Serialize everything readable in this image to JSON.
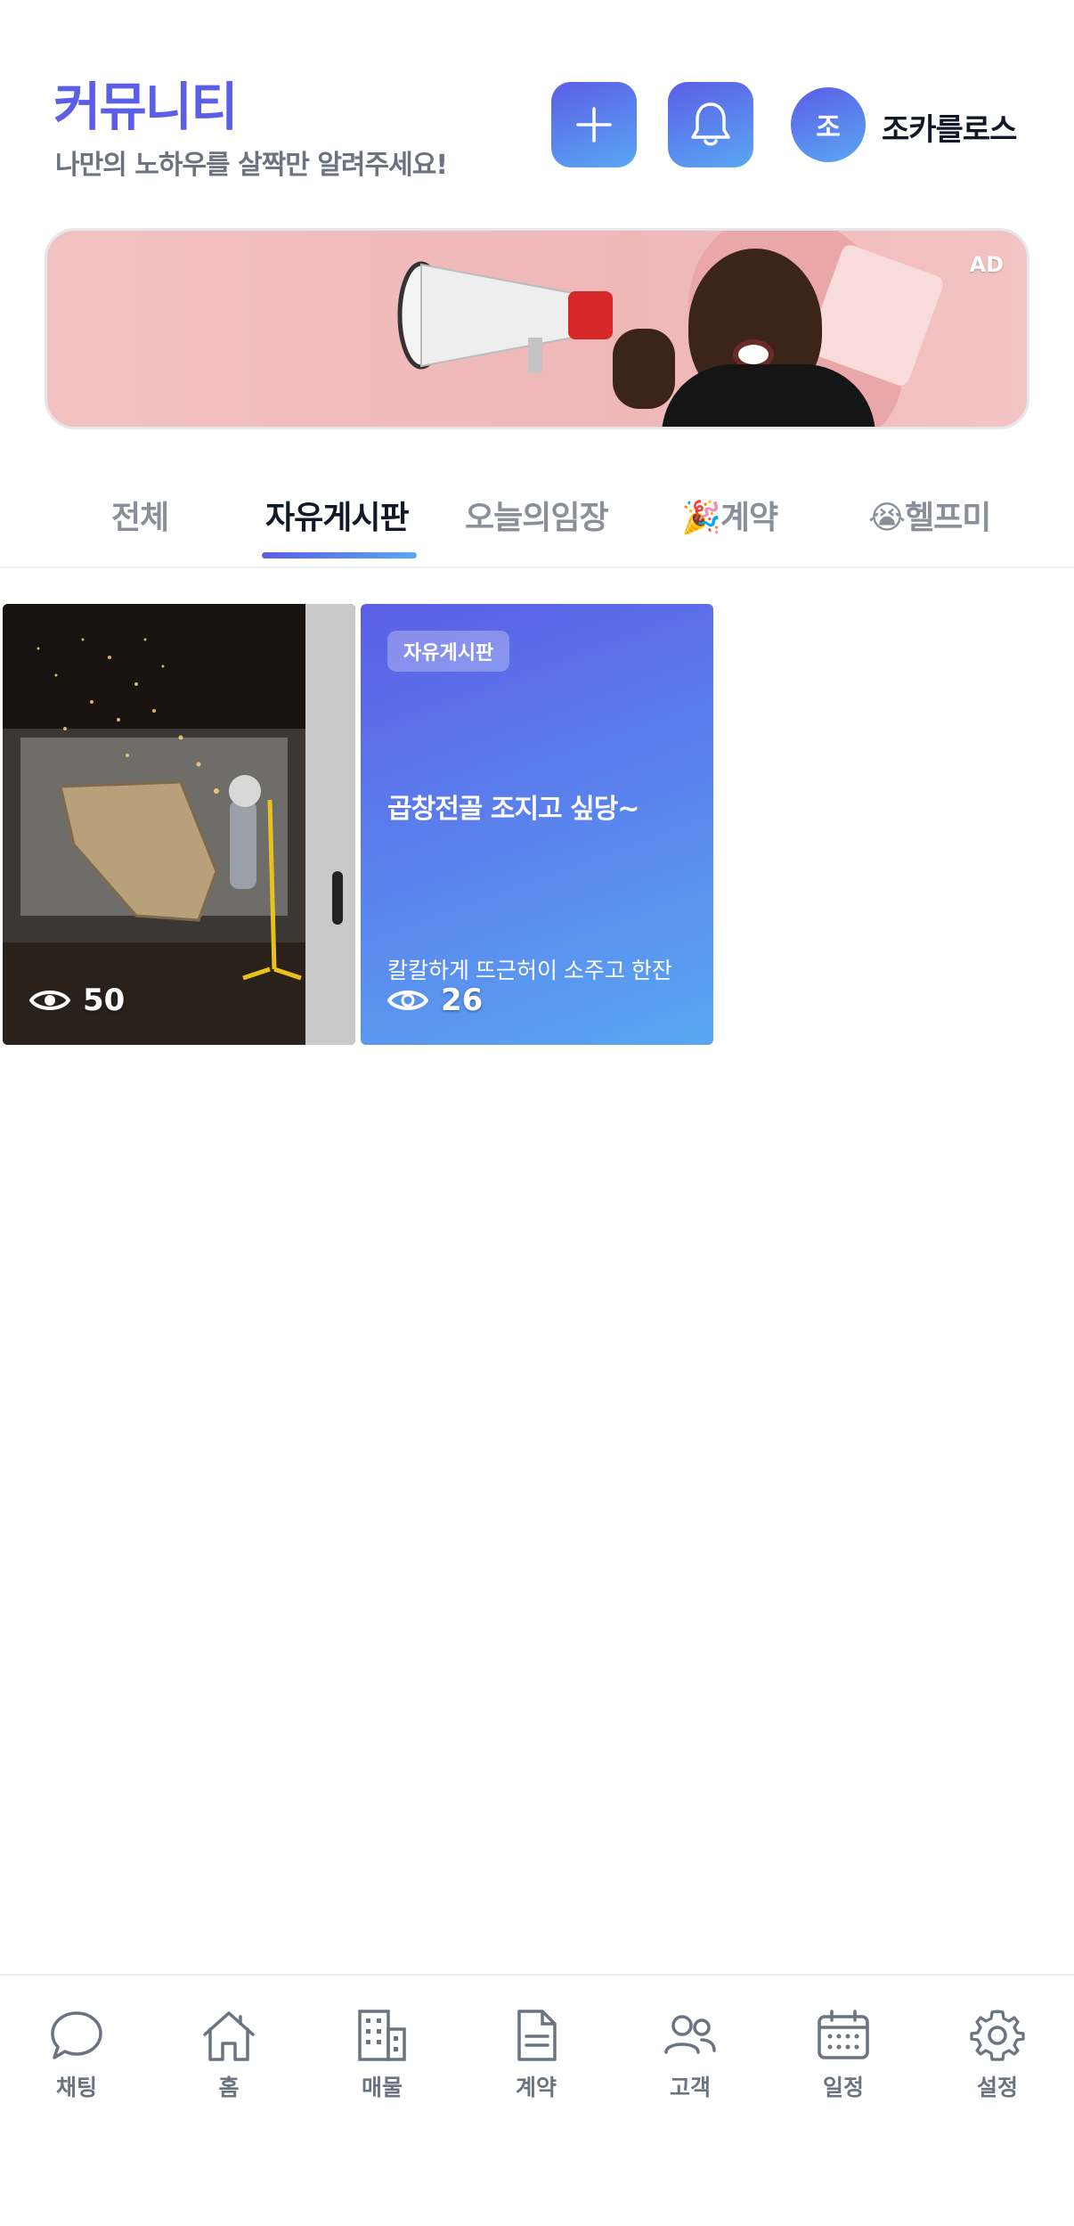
{
  "header": {
    "title": "커뮤니티",
    "subtitle": "나만의 노하우를 살짝만 알려주세요!",
    "avatar_initial": "조",
    "username": "조카를로스"
  },
  "ad": {
    "label": "AD"
  },
  "tabs": [
    {
      "label": "전체",
      "active": false
    },
    {
      "label": "자유게시판",
      "active": true
    },
    {
      "label": "오늘의임장",
      "active": false
    },
    {
      "label": "🎉계약",
      "active": false
    },
    {
      "label": "😭헬프미",
      "active": false
    }
  ],
  "posts": [
    {
      "type": "photo",
      "views": "50"
    },
    {
      "type": "text",
      "category": "자유게시판",
      "title": "곱창전골 조지고 싶당~",
      "preview": "칼칼하게 뜨근허이 소주고 한잔",
      "views": "26"
    }
  ],
  "bottom_nav": [
    {
      "label": "채팅",
      "icon": "chat-icon"
    },
    {
      "label": "홈",
      "icon": "home-icon"
    },
    {
      "label": "매물",
      "icon": "building-icon"
    },
    {
      "label": "계약",
      "icon": "document-icon"
    },
    {
      "label": "고객",
      "icon": "users-icon"
    },
    {
      "label": "일정",
      "icon": "calendar-icon"
    },
    {
      "label": "설정",
      "icon": "gear-icon"
    }
  ],
  "colors": {
    "accent": "#5b5ee6",
    "accent_end": "#5aa7f3",
    "muted": "#6b7280"
  }
}
